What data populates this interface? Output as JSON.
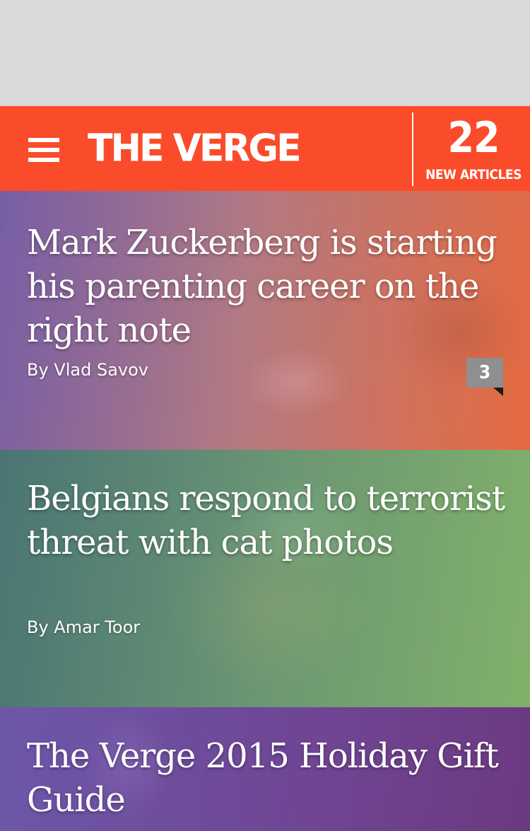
{
  "header": {
    "logo_text": "THE VERGE",
    "new_articles_count": "22",
    "new_articles_label": "NEW ARTICLES",
    "brand_color": "#fa4b2a"
  },
  "stories": [
    {
      "title": "Mark Zuckerberg is starting his parenting career on the right note",
      "byline": "By Vlad Savov",
      "comment_count": "3",
      "tint_color": "#a060a0"
    },
    {
      "title": "Belgians respond to terrorist threat with cat photos",
      "byline": "By Amar Toor",
      "tint_color": "#4f8a70"
    },
    {
      "title": "The Verge 2015 Holiday Gift Guide",
      "tint_color": "#6a48a0"
    }
  ],
  "icons": {
    "menu": "hamburger-menu-icon"
  }
}
